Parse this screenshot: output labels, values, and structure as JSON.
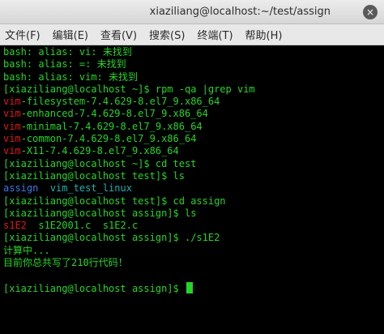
{
  "window": {
    "title": "xiaziliang@localhost:~/test/assign",
    "close_glyph": "×"
  },
  "menu": {
    "items": [
      {
        "label": "文件(F)"
      },
      {
        "label": "编辑(E)"
      },
      {
        "label": "查看(V)"
      },
      {
        "label": "搜索(S)"
      },
      {
        "label": "终端(T)"
      },
      {
        "label": "帮助(H)"
      }
    ]
  },
  "terminal": {
    "lines": [
      "bash: alias: vi: 未找到",
      "bash: alias: =: 未找到",
      "bash: alias: vim: 未找到",
      "[xiaziliang@localhost ~]$ rpm -qa |grep vim",
      {
        "match": "vim",
        "rest": "-filesystem-7.4.629-8.el7_9.x86_64"
      },
      {
        "match": "vim",
        "rest": "-enhanced-7.4.629-8.el7_9.x86_64"
      },
      {
        "match": "vim",
        "rest": "-minimal-7.4.629-8.el7_9.x86_64"
      },
      {
        "match": "vim",
        "rest": "-common-7.4.629-8.el7_9.x86_64"
      },
      {
        "match": "vim",
        "rest": "-X11-7.4.629-8.el7_9.x86_64"
      },
      "[xiaziliang@localhost ~]$ cd test",
      "[xiaziliang@localhost test]$ ls",
      {
        "dir": "assign",
        "sep": "  ",
        "dir2": "vim_test_linux"
      },
      "[xiaziliang@localhost test]$ cd assign",
      "[xiaziliang@localhost assign]$ ls",
      {
        "exe": "s1E2",
        "rest": "  s1E2001.c  s1E2.c"
      },
      "[xiaziliang@localhost assign]$ ./s1E2",
      "计算中...",
      "目前你总共写了210行代码！",
      "",
      "[xiaziliang@localhost assign]$ "
    ]
  }
}
